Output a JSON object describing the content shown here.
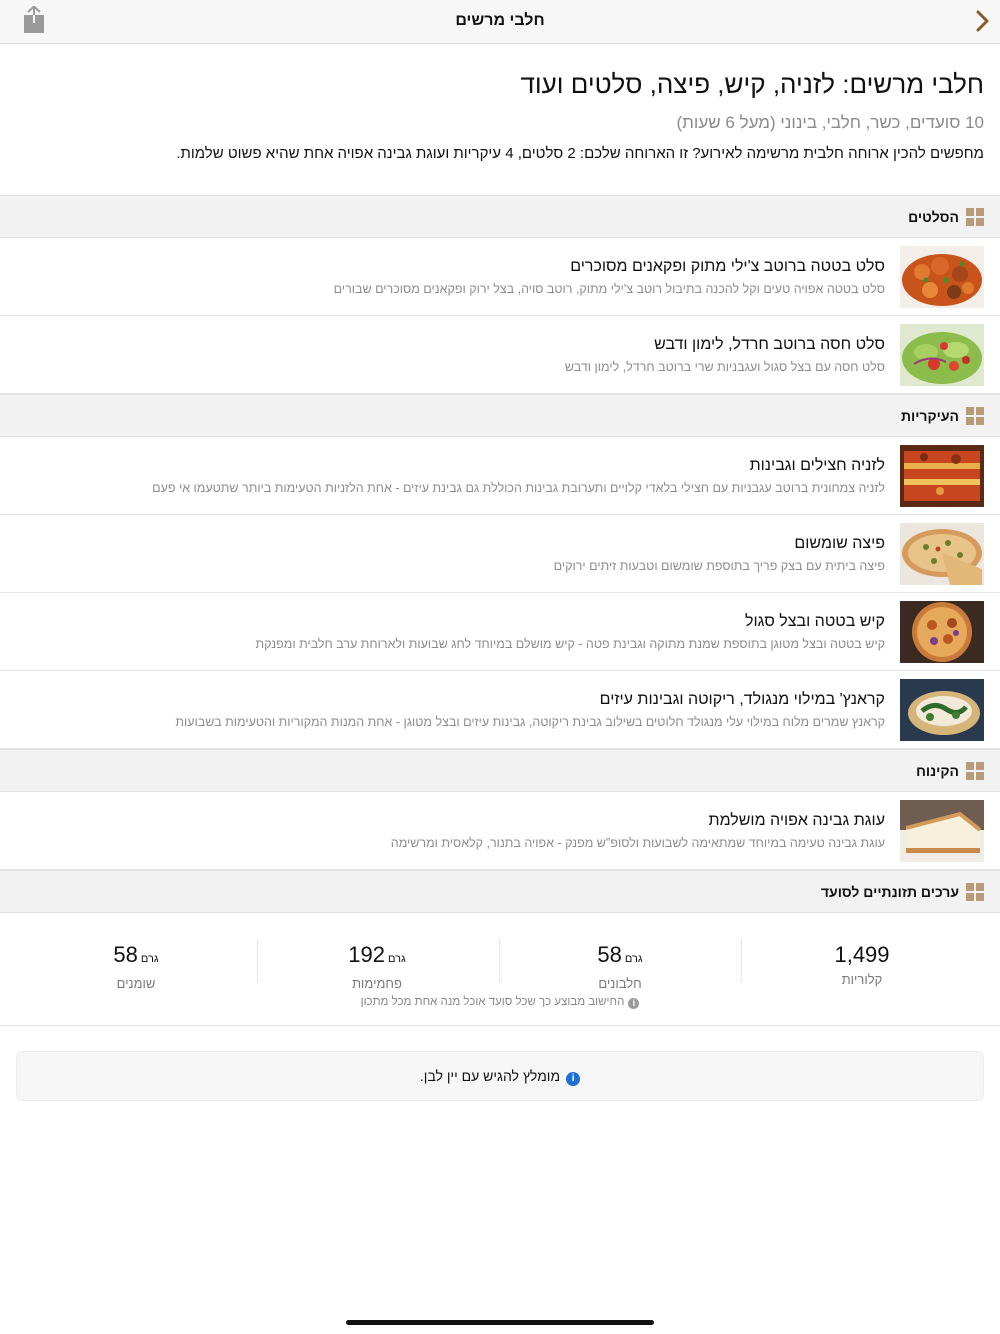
{
  "nav": {
    "title": "חלבי מרשים",
    "back_icon": "chevron-right-icon",
    "share_icon": "share-icon",
    "accent_color": "#8a5a2b"
  },
  "header": {
    "title": "חלבי מרשים: לזניה, קיש, פיצה, סלטים ועוד",
    "meta": "10 סועדים, כשר, חלבי, בינוני (מעל 6 שעות)",
    "intro": "מחפשים להכין ארוחה חלבית מרשימה לאירוע? זו הארוחה שלכם: 2 סלטים, 4 עיקריות ועוגת גבינה אפויה אחת שהיא פשוט שלמות."
  },
  "sections": [
    {
      "label": "הסלטים",
      "icon": "grid-icon",
      "recipes": [
        {
          "name": "סלט בטטה ברוטב צ'ילי מתוק ופקאנים מסוכרים",
          "desc": "סלט בטטה אפויה טעים וקל להכנה בתיבול רוטב צ'ילי מתוק, רוטב סויה, בצל ירוק ופקאנים מסוכרים שבורים"
        },
        {
          "name": "סלט חסה ברוטב חרדל, לימון ודבש",
          "desc": "סלט חסה עם בצל סגול ועגבניות שרי ברוטב חרדל, לימון ודבש"
        }
      ]
    },
    {
      "label": "העיקריות",
      "icon": "grid-icon",
      "recipes": [
        {
          "name": "לזניה חצילים וגבינות",
          "desc": "לזניה צמחונית ברוטב עגבניות עם חצילי בלאדי קלויים ותערובת גבינות הכוללת גם גבינת עיזים - אחת הלזניות הטעימות ביותר שתטעמו אי פעם"
        },
        {
          "name": "פיצה שומשום",
          "desc": "פיצה ביתית עם בצק פריך בתוספת שומשום וטבעות זיתים ירוקים"
        },
        {
          "name": "קיש בטטה ובצל סגול",
          "desc": "קיש בטטה ובצל מטוגן בתוספת שמנת מתוקה וגבינת פטה - קיש מושלם במיוחד לחג שבועות ולארוחת ערב חלבית ומפנקת"
        },
        {
          "name": "קראנץ' במילוי מנגולד, ריקוטה וגבינות עיזים",
          "desc": "קראנץ שמרים מלוח במילוי עלי מנגולד חלוטים בשילוב גבינת ריקוטה, גבינות עיזים ובצל מטוגן - אחת המנות המקוריות והטעימות בשבועות"
        }
      ]
    },
    {
      "label": "הקינוח",
      "icon": "grid-icon",
      "recipes": [
        {
          "name": "עוגת גבינה אפויה מושלמת",
          "desc": "עוגת גבינה טעימה במיוחד שמתאימה לשבועות ולסופ\"ש מפנק - אפויה בתנור, קלאסית ומרשימה"
        }
      ]
    },
    {
      "label": "ערכים תזונתיים לסועד",
      "icon": "grid-icon"
    }
  ],
  "nutrition": {
    "items": [
      {
        "value": "1,499",
        "unit": "",
        "label": "קלוריות"
      },
      {
        "value": "58",
        "unit": "גרם",
        "label": "חלבונים"
      },
      {
        "value": "192",
        "unit": "גרם",
        "label": "פחמימות"
      },
      {
        "value": "58",
        "unit": "גרם",
        "label": "שומנים"
      }
    ],
    "note_icon": "info-icon",
    "note": "החישוב מבוצע כך שכל סועד אוכל מנה אחת מכל מתכון"
  },
  "tip": {
    "icon": "info-icon",
    "text": "מומלץ להגיש עם יין לבן.",
    "icon_color": "#1f6fd6"
  }
}
